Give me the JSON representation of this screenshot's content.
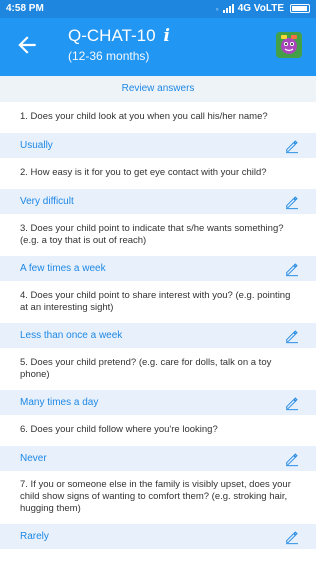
{
  "status_bar": {
    "time": "4:58 PM",
    "network": "4G VoLTE"
  },
  "app_bar": {
    "title": "Q-CHAT-10",
    "info_icon": "i",
    "subtitle": "(12-36 months)",
    "back_icon": "arrow-back-icon",
    "logo_icon": "app-logo-icon"
  },
  "review_header": "Review answers",
  "questions": [
    {
      "question": "1. Does your child look at you when you call his/her name?",
      "answer": "Usually"
    },
    {
      "question": "2. How easy is it for you to get eye contact with your child?",
      "answer": "Very difficult"
    },
    {
      "question": "3. Does your child point to indicate that s/he wants something?  (e.g. a toy that is  out of reach)",
      "answer": "A few times a week"
    },
    {
      "question": "4. Does your child point to share interest with you? (e.g. pointing at an interesting sight)",
      "answer": "Less than once a week"
    },
    {
      "question": "5. Does your child pretend? (e.g. care for dolls, talk on a toy phone)",
      "answer": "Many times a day"
    },
    {
      "question": "6. Does your child follow where you're looking?",
      "answer": "Never"
    },
    {
      "question": "7. If you or someone else in the family is visibly upset, does your child show signs of wanting to comfort them?  (e.g. stroking hair, hugging them)",
      "answer": "Rarely"
    }
  ],
  "colors": {
    "status_bar": "#1f86e0",
    "app_bar": "#2196f3",
    "accent": "#1e88e5",
    "answer_bg": "#e7f0fb",
    "review_bg": "#eef3f8"
  }
}
